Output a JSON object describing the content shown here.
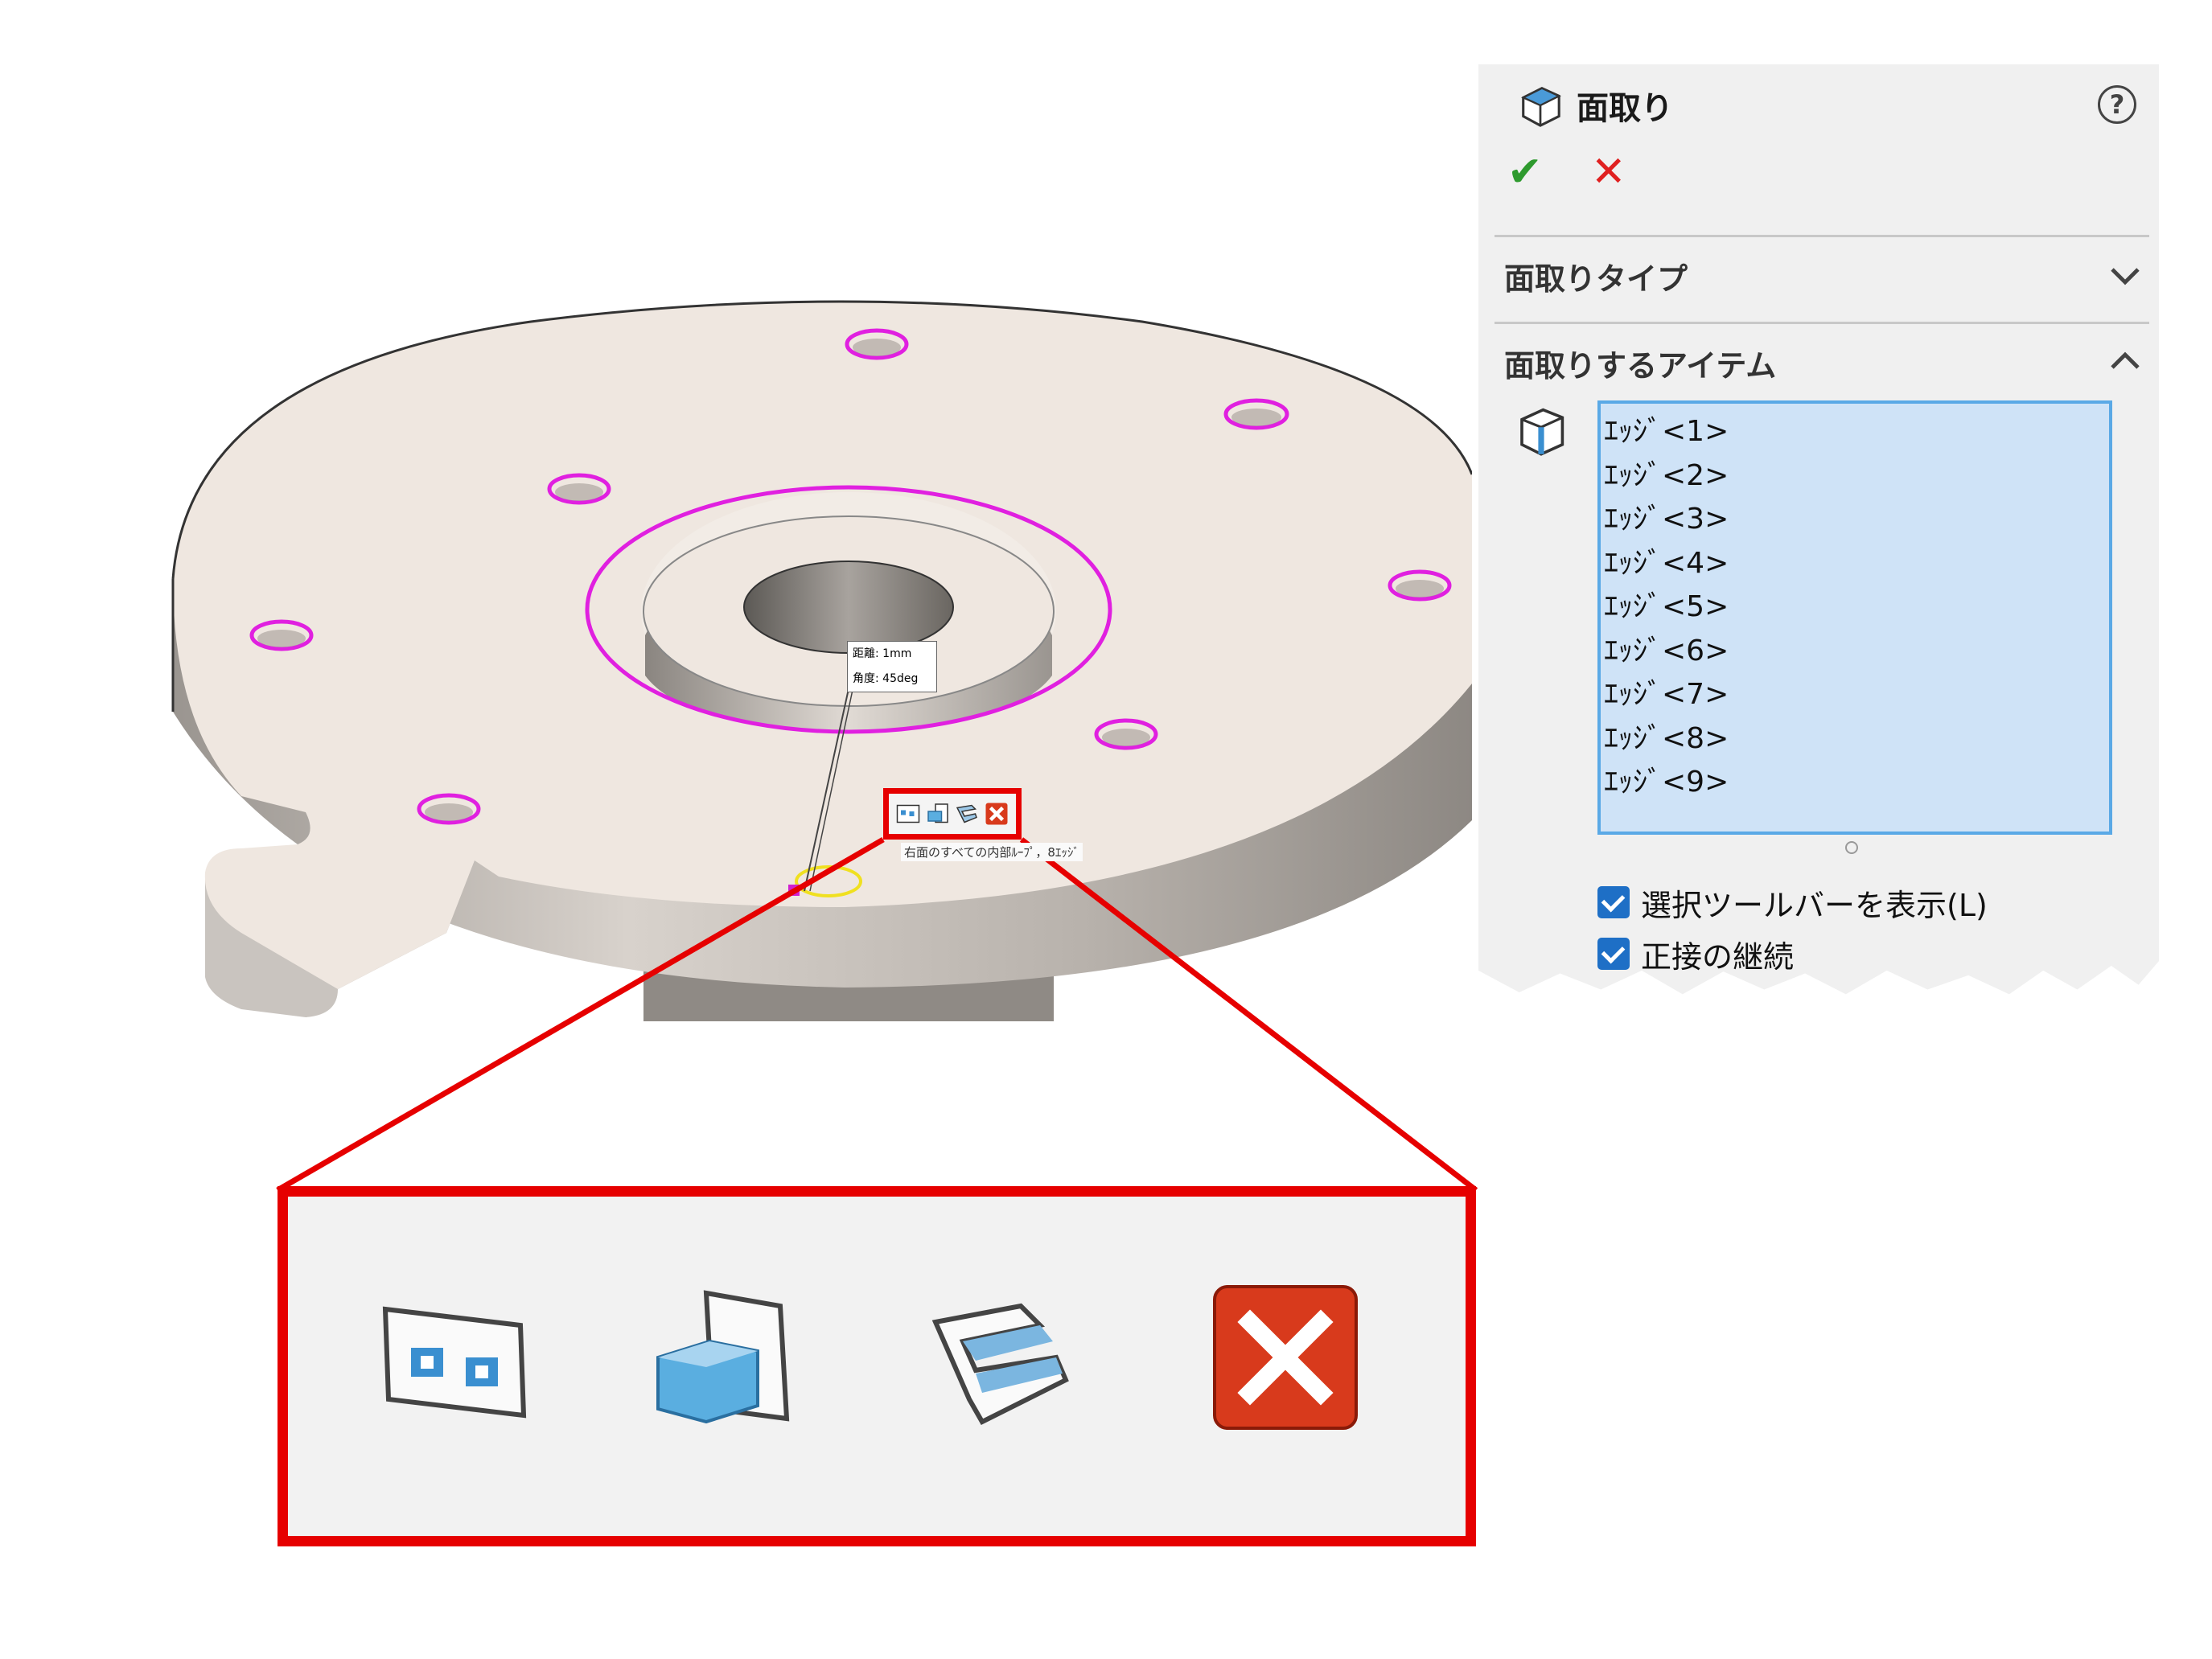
{
  "panel": {
    "title": "面取り",
    "help_label": "?",
    "ok_label": "✔",
    "cancel_label": "✕",
    "section_type": "面取りタイプ",
    "section_items": "面取りするアイテム",
    "edges": [
      "ｴｯｼﾞ<1>",
      "ｴｯｼﾞ<2>",
      "ｴｯｼﾞ<3>",
      "ｴｯｼﾞ<4>",
      "ｴｯｼﾞ<5>",
      "ｴｯｼﾞ<6>",
      "ｴｯｼﾞ<7>",
      "ｴｯｼﾞ<8>",
      "ｴｯｼﾞ<9>"
    ],
    "checkbox_1": "選択ツールバーを表示(L)",
    "checkbox_2": "正接の継続"
  },
  "viewport": {
    "dim_distance": "距離: 1mm",
    "dim_angle": "角度: 45deg",
    "tooltip": "右面のすべての内部ﾙｰﾌﾟ，8ｴｯｼﾞ"
  },
  "colors": {
    "highlight": "#e020e0",
    "callout_red": "#e60000",
    "selection_blue": "#cfe3f7",
    "part_face": "#efe7e0"
  },
  "icons": [
    "chamfer-feature-icon",
    "help-icon",
    "ok-check-icon",
    "cancel-x-icon",
    "chevron-down-icon",
    "chevron-up-icon",
    "edge-selector-icon",
    "select-inner-loops-icon",
    "select-connected-icon",
    "select-tangent-icon",
    "close-toolbar-icon"
  ]
}
